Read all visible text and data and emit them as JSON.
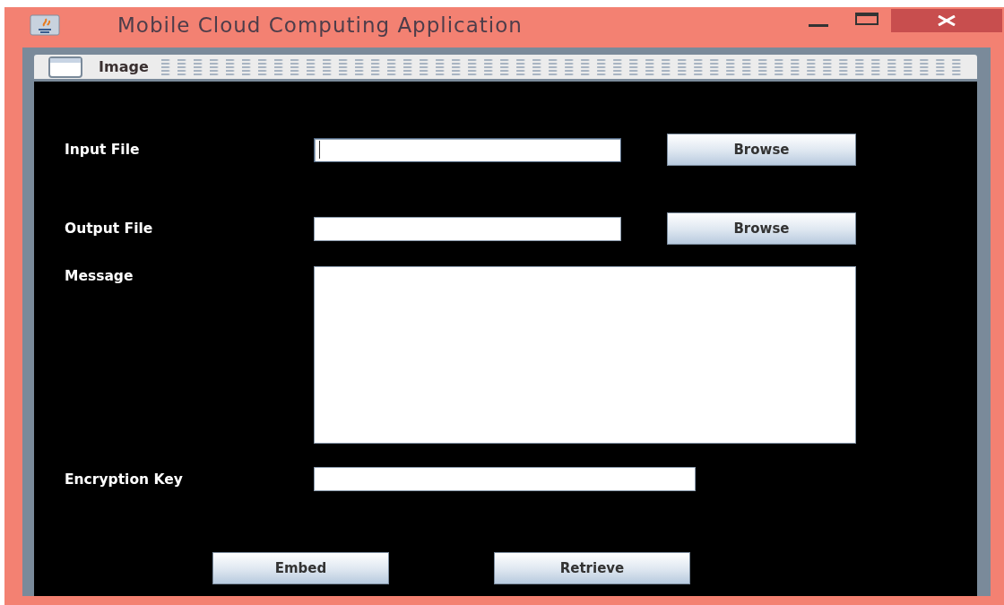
{
  "window": {
    "title": "Mobile Cloud Computing Application"
  },
  "internal_frame": {
    "title": "Image"
  },
  "form": {
    "rows": [
      {
        "kind": "file",
        "label": "Input File",
        "focused": true,
        "button": "Browse"
      },
      {
        "kind": "file",
        "label": "Output File",
        "focused": false,
        "button": "Browse"
      },
      {
        "kind": "textarea",
        "label": "Message",
        "focused": false
      },
      {
        "kind": "text",
        "label": "Encryption Key",
        "focused": false
      }
    ]
  },
  "buttons": [
    "Embed",
    "Retrieve"
  ]
}
